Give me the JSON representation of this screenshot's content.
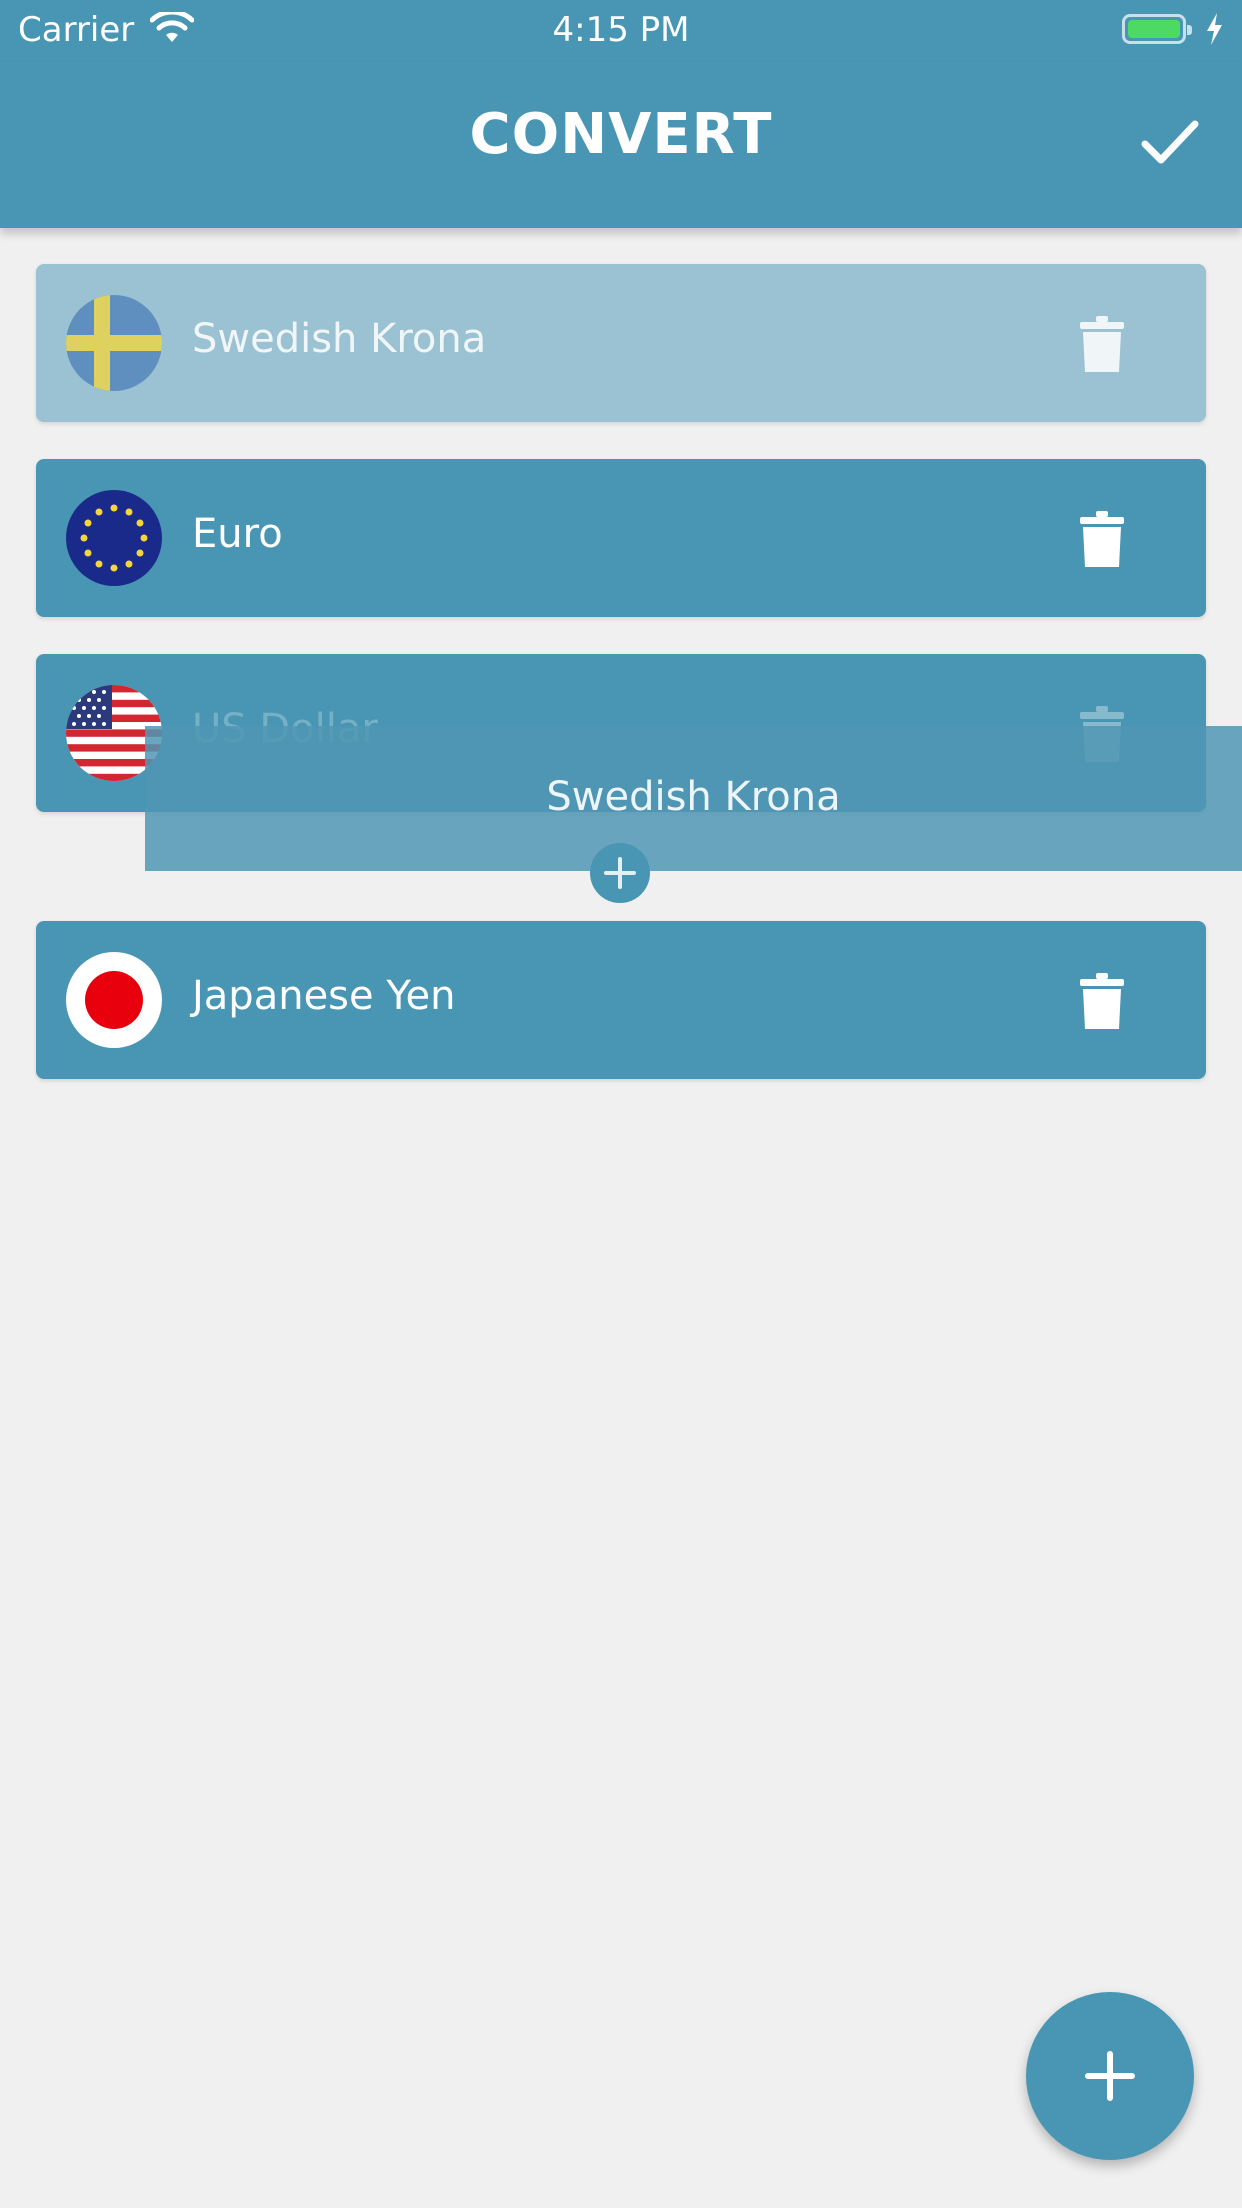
{
  "status_bar": {
    "carrier": "Carrier",
    "time": "4:15 PM"
  },
  "nav": {
    "title": "CONVERT",
    "confirm_icon": "checkmark-icon"
  },
  "currencies": [
    {
      "label": "Swedish Krona",
      "flag": "sweden-flag-icon",
      "state": "faded"
    },
    {
      "label": "Euro",
      "flag": "eu-flag-icon",
      "state": "normal"
    },
    {
      "label": "US Dollar",
      "flag": "us-flag-icon",
      "state": "dimmed"
    },
    {
      "label": "Japanese Yen",
      "flag": "japan-flag-icon",
      "state": "normal"
    }
  ],
  "drag_item": {
    "label": "Swedish Krona"
  },
  "fab": {
    "icon": "plus-icon"
  },
  "colors": {
    "primary": "#4896b3",
    "background": "#f0f0f1",
    "faded_row": "#9bc2d2",
    "battery": "#4cd964"
  }
}
